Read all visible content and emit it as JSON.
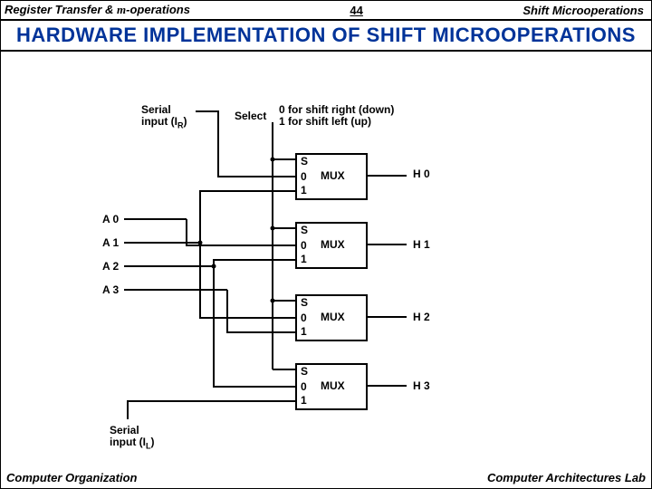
{
  "header": {
    "left_a": "Register Transfer & ",
    "left_b": "-operations",
    "mu": "m",
    "center": "44",
    "right": "Shift Microoperations"
  },
  "title": "HARDWARE  IMPLEMENTATION  OF  SHIFT  MICROOPERATIONS",
  "footer": {
    "left": "Computer Organization",
    "right": "Computer Architectures Lab"
  },
  "diagram": {
    "serial_right_a": "Serial",
    "serial_right_b": "input (I",
    "serial_right_sub": "R",
    "serial_right_c": ")",
    "select": "Select",
    "select_line0": "0 for shift right (down)",
    "select_line1": "1 for shift left (up)",
    "mux": "MUX",
    "s": "S",
    "zero": "0",
    "one": "1",
    "A": [
      "A 0",
      "A 1",
      "A 2",
      "A 3"
    ],
    "H": [
      "H 0",
      "H 1",
      "H 2",
      "H 3"
    ],
    "serial_left_a": "Serial",
    "serial_left_b": "input (I",
    "serial_left_sub": "L",
    "serial_left_c": ")"
  },
  "chart_data": {
    "type": "diagram",
    "description": "4-bit combinational shifter built from four 2-to-1 multiplexers",
    "select_signal": {
      "0": "shift right (down)",
      "1": "shift left (up)"
    },
    "inputs": [
      "A0",
      "A1",
      "A2",
      "A3",
      "I_R (serial input right)",
      "I_L (serial input left)"
    ],
    "outputs": [
      "H0",
      "H1",
      "H2",
      "H3"
    ],
    "mux_connections": [
      {
        "output": "H0",
        "input_0": "I_R",
        "input_1": "A1"
      },
      {
        "output": "H1",
        "input_0": "A0",
        "input_1": "A2"
      },
      {
        "output": "H2",
        "input_0": "A1",
        "input_1": "A3"
      },
      {
        "output": "H3",
        "input_0": "A2",
        "input_1": "I_L"
      }
    ]
  }
}
